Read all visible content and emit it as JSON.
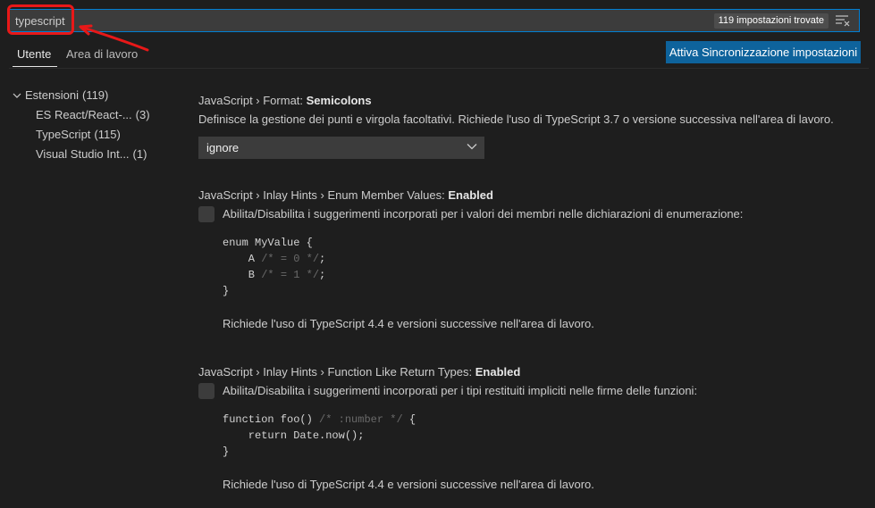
{
  "search": {
    "value": "typescript",
    "result_count": "119 impostazioni trovate"
  },
  "tabs": {
    "user": "Utente",
    "workspace": "Area di lavoro"
  },
  "sync_button": "Attiva Sincronizzazione impostazioni",
  "toc": {
    "group_label": "Estensioni",
    "group_count": "(119)",
    "items": [
      {
        "label": "ES React/React-...",
        "count": "(3)"
      },
      {
        "label": "TypeScript",
        "count": "(115)"
      },
      {
        "label": "Visual Studio Int...",
        "count": "(1)"
      }
    ]
  },
  "settings": [
    {
      "category": "JavaScript › Format: ",
      "name": "Semicolons",
      "description": "Definisce la gestione dei punti e virgola facoltativi. Richiede l'uso di TypeScript 3.7 o versione successiva nell'area di lavoro.",
      "select_value": "ignore"
    },
    {
      "category": "JavaScript › Inlay Hints › Enum Member Values: ",
      "name": "Enabled",
      "description": "Abilita/Disabilita i suggerimenti incorporati per i valori dei membri nelle dichiarazioni di enumerazione:",
      "code": {
        "line1_kw": "enum MyValue {",
        "line2_code": "    A ",
        "line2_comment": "/* = 0 */",
        "line2_end": ";",
        "line3_code": "    B ",
        "line3_comment": "/* = 1 */",
        "line3_end": ";",
        "line4": "}"
      },
      "requires": "Richiede l'uso di TypeScript 4.4 e versioni successive nell'area di lavoro."
    },
    {
      "category": "JavaScript › Inlay Hints › Function Like Return Types: ",
      "name": "Enabled",
      "description": "Abilita/Disabilita i suggerimenti incorporati per i tipi restituiti impliciti nelle firme delle funzioni:",
      "code": {
        "line1_code": "function foo() ",
        "line1_comment": "/* :number */",
        "line1_end": " {",
        "line2": "    return Date.now();",
        "line3": "}"
      },
      "requires": "Richiede l'uso di TypeScript 4.4 e versioni successive nell'area di lavoro."
    }
  ],
  "icons": {
    "filter": "clear-filter-icon",
    "chevron": "chevron-down-icon"
  },
  "colors": {
    "accent": "#007fd4",
    "button": "#0e639c",
    "annotation": "#e81818"
  }
}
